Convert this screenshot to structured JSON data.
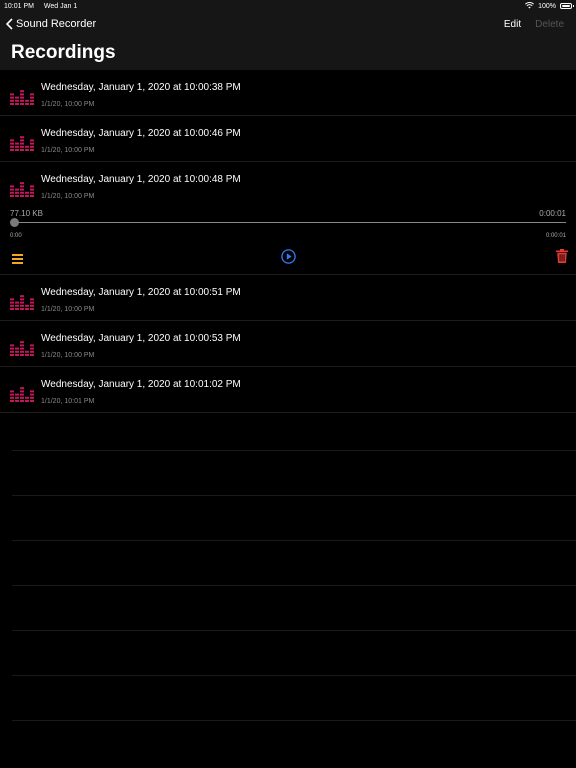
{
  "status": {
    "time": "10:01 PM",
    "date": "Wed Jan 1",
    "battery": "100%"
  },
  "nav": {
    "back_label": "Sound Recorder",
    "edit_label": "Edit",
    "delete_label": "Delete",
    "title": "Recordings"
  },
  "recordings_top": [
    {
      "title": "Wednesday, January 1, 2020 at 10:00:38 PM",
      "subtitle": "1/1/20, 10:00 PM"
    },
    {
      "title": "Wednesday, January 1, 2020 at 10:00:46 PM",
      "subtitle": "1/1/20, 10:00 PM"
    },
    {
      "title": "Wednesday, January 1, 2020 at 10:00:48 PM",
      "subtitle": "1/1/20, 10:00 PM"
    }
  ],
  "player": {
    "size": "77.10 KB",
    "duration": "0:00:01",
    "elapsed": "0:00",
    "end": "0:00:01",
    "progress": 0
  },
  "recordings_bottom": [
    {
      "title": "Wednesday, January 1, 2020 at 10:00:51 PM",
      "subtitle": "1/1/20, 10:00 PM"
    },
    {
      "title": "Wednesday, January 1, 2020 at 10:00:53 PM",
      "subtitle": "1/1/20, 10:00 PM"
    },
    {
      "title": "Wednesday, January 1, 2020 at 10:01:02 PM",
      "subtitle": "1/1/20, 10:01 PM"
    }
  ],
  "colors": {
    "accent_pink": "#c2185b",
    "menu_orange": "#f5a623",
    "play_blue": "#2f7cf6",
    "delete_red": "#e53935"
  }
}
